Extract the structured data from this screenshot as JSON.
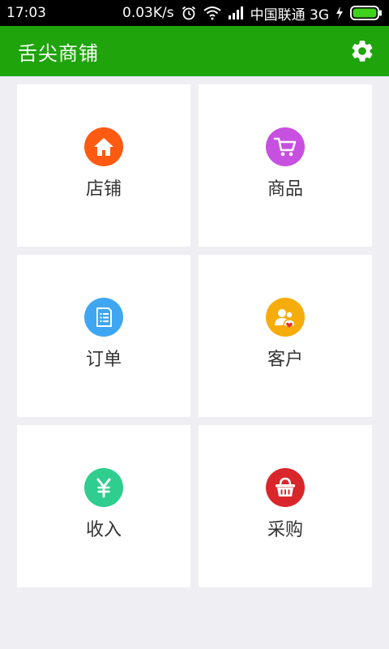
{
  "status_bar": {
    "time": "17:03",
    "speed": "0.03K/s",
    "carrier": "中国联通 3G"
  },
  "app_bar": {
    "title": "舌尖商铺",
    "settings_icon": "gear-icon"
  },
  "tiles": [
    {
      "label": "店铺",
      "icon": "home-icon",
      "color": "#ff5a12"
    },
    {
      "label": "商品",
      "icon": "shopping-cart-icon",
      "color": "#c750e0"
    },
    {
      "label": "订单",
      "icon": "document-list-icon",
      "color": "#3fa6f2"
    },
    {
      "label": "客户",
      "icon": "customers-icon",
      "color": "#f6ad0c"
    },
    {
      "label": "收入",
      "icon": "yuan-icon",
      "color": "#2fcd8e"
    },
    {
      "label": "采购",
      "icon": "basket-icon",
      "color": "#d9262a"
    }
  ],
  "colors": {
    "app_bar": "#1fa40b",
    "background": "#eeeef3",
    "status_bar": "#000000"
  }
}
